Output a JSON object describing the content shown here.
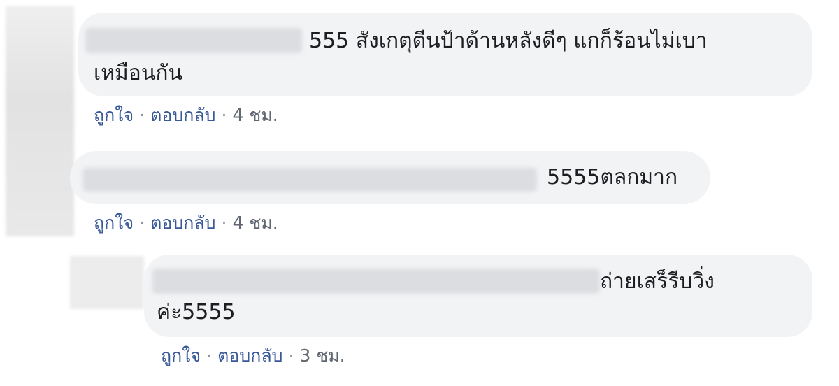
{
  "comments": [
    {
      "text_line1": "555 สังเกตุตีนป้าด้านหลังดีๆ แกก็ร้อนไม่เบา",
      "text_line2": "เหมือนกัน",
      "like": "ถูกใจ",
      "reply": "ตอบกลับ",
      "time": "4 ชม."
    },
    {
      "text_line1": "5555ตลกมาก",
      "like": "ถูกใจ",
      "reply": "ตอบกลับ",
      "time": "4 ชม."
    },
    {
      "text_line1": "ถ่ายเสร็รีบวิ่ง",
      "text_line2": "ค่ะ5555",
      "like": "ถูกใจ",
      "reply": "ตอบกลับ",
      "time": "3 ชม."
    }
  ],
  "separator": "·",
  "colors": {
    "bubble": "#f2f3f5",
    "link": "#385898",
    "meta": "#606770"
  }
}
